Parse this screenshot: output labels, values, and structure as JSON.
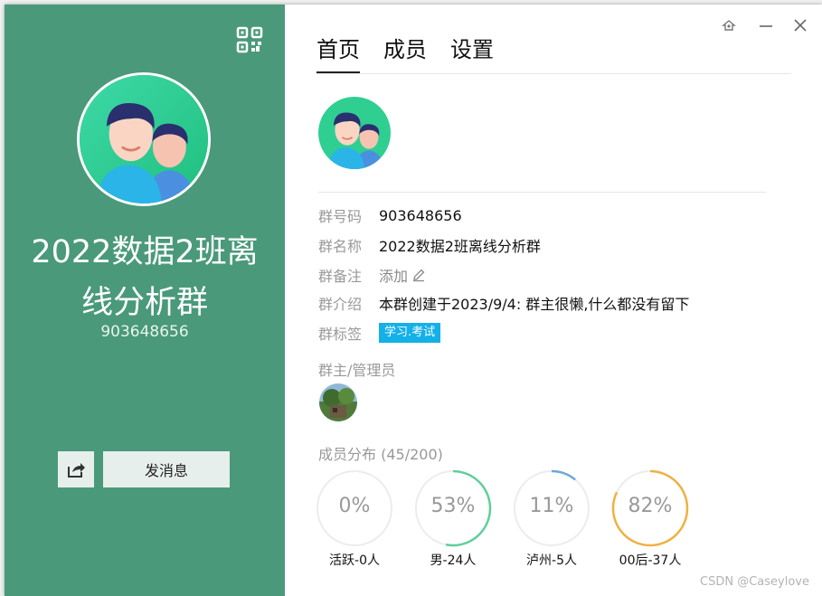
{
  "group": {
    "name_line1": "2022数据2班离",
    "name_line2": "线分析群",
    "id": "903648656"
  },
  "left_panel": {
    "bg_color": "#4a997b",
    "send_message_label": "发消息"
  },
  "tabs": [
    {
      "label": "首页",
      "active": true
    },
    {
      "label": "成员",
      "active": false
    },
    {
      "label": "设置",
      "active": false
    }
  ],
  "info": {
    "id_label": "群号码",
    "id_value": "903648656",
    "name_label": "群名称",
    "name_value": "2022数据2班离线分析群",
    "remark_label": "群备注",
    "remark_value": "添加",
    "intro_label": "群介绍",
    "intro_value": "本群创建于2023/9/4:  群主很懒,什么都没有留下",
    "tag_label": "群标签",
    "tag_value": "学习.考试",
    "tag_color": "#14b0e8"
  },
  "admins": {
    "label": "群主/管理员"
  },
  "distribution": {
    "label": "成员分布",
    "count": "(45/200)",
    "stats": [
      {
        "pct_text": "0%",
        "pct": 0,
        "label": "活跃-0人",
        "color": "#e6e6e6"
      },
      {
        "pct_text": "53%",
        "pct": 0.53,
        "label": "男-24人",
        "color": "#5ecf9b"
      },
      {
        "pct_text": "11%",
        "pct": 0.11,
        "label": "泸州-5人",
        "color": "#6fa8dc"
      },
      {
        "pct_text": "82%",
        "pct": 0.82,
        "label": "00后-37人",
        "color": "#f0b042"
      }
    ]
  },
  "watermark": "CSDN @Caseylove",
  "icons": {
    "qr": "qr-code-icon",
    "share": "share-icon",
    "edit": "pencil-icon",
    "pin": "pin-icon",
    "minimize": "minimize-icon",
    "close": "close-icon"
  }
}
